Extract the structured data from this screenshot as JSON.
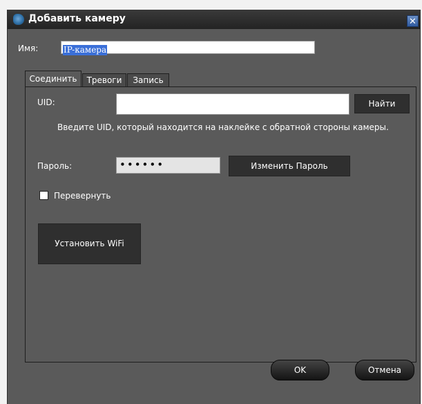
{
  "window": {
    "title": "Добавить камеру",
    "close_glyph": "✕"
  },
  "name_field": {
    "label": "Имя:",
    "value": "IP-камера"
  },
  "tabs": [
    {
      "label": "Соединить",
      "active": true
    },
    {
      "label": "Тревоги",
      "active": false
    },
    {
      "label": "Запись",
      "active": false
    }
  ],
  "connect": {
    "uid_label": "UID:",
    "uid_value": "",
    "find_button": "Найти",
    "uid_hint": "Введите UID, который находится на наклейке с обратной стороны камеры.",
    "password_label": "Пароль:",
    "password_value": "••••••",
    "change_password_button": "Изменить Пароль",
    "flip_label": "Перевернуть",
    "flip_checked": false,
    "wifi_button": "Установить WiFi"
  },
  "footer": {
    "ok_button": "OK",
    "cancel_button": "Отмена"
  },
  "icons": {
    "app": "camera-app-icon",
    "close": "close-icon"
  },
  "colors": {
    "dialog_bg": "#5a5a5a",
    "titlebar": "#232323",
    "selection": "#3a6fd8",
    "button_dark": "#2f2f2f"
  }
}
